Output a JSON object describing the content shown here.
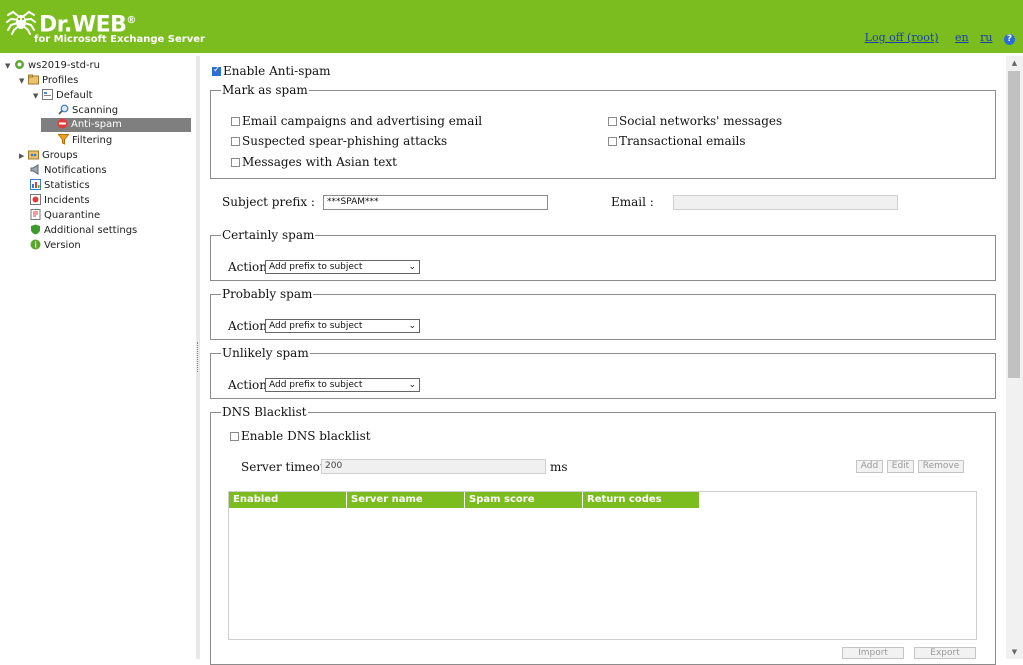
{
  "header": {
    "brand": "Dr.WEB",
    "brand_mark": "®",
    "subtitle": "for Microsoft Exchange Server",
    "logoff": "Log off (root)",
    "lang_en": "en",
    "lang_ru": "ru",
    "help": "?"
  },
  "tree": {
    "server": "ws2019-std-ru",
    "profiles": "Profiles",
    "default": "Default",
    "scanning": "Scanning",
    "antispam": "Anti-spam",
    "filtering": "Filtering",
    "groups": "Groups",
    "notifications": "Notifications",
    "statistics": "Statistics",
    "incidents": "Incidents",
    "quarantine": "Quarantine",
    "additional": "Additional settings",
    "version": "Version"
  },
  "antispam": {
    "enable_label": "Enable Anti-spam",
    "mark_as_spam": {
      "legend": "Mark as spam",
      "email_campaigns": "Email campaigns and advertising email",
      "spear_phishing": "Suspected spear-phishing attacks",
      "asian_text": "Messages with Asian text",
      "social_networks": "Social networks' messages",
      "transactional": "Transactional emails"
    },
    "subject_prefix_label": "Subject prefix :",
    "subject_prefix_value": "***SPAM***",
    "email_label": "Email :",
    "email_value": "",
    "certainly": {
      "legend": "Certainly spam",
      "action_label": "Action",
      "action_value": "Add prefix to subject"
    },
    "probably": {
      "legend": "Probably spam",
      "action_label": "Action",
      "action_value": "Add prefix to subject"
    },
    "unlikely": {
      "legend": "Unlikely spam",
      "action_label": "Action",
      "action_value": "Add prefix to subject"
    },
    "dns": {
      "legend": "DNS Blacklist",
      "enable_label": "Enable DNS blacklist",
      "timeout_label": "Server timeout:",
      "timeout_value": "200",
      "timeout_unit": "ms",
      "add": "Add",
      "edit": "Edit",
      "remove": "Remove",
      "columns": [
        "Enabled",
        "Server name",
        "Spam score",
        "Return codes"
      ],
      "import": "Import",
      "export": "Export"
    }
  },
  "colors": {
    "brand_green": "#7bbc1f",
    "link_blue": "#1a3fa8",
    "selected_gray": "#7f7f7f"
  }
}
